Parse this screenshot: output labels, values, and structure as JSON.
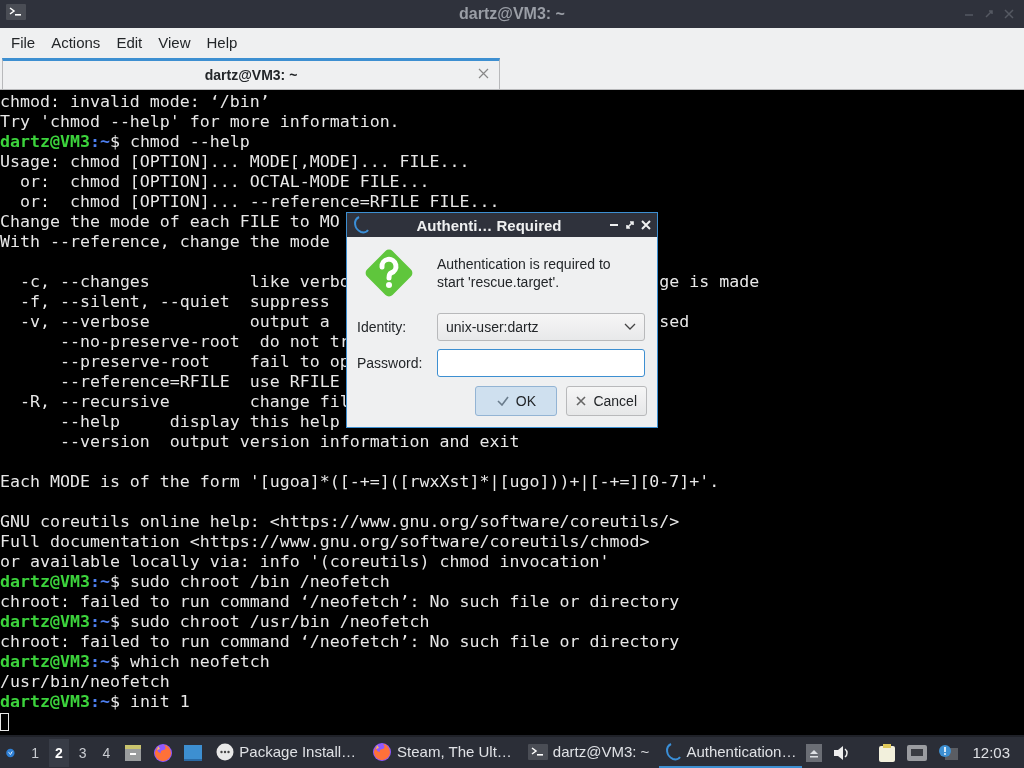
{
  "window": {
    "title": "dartz@VM3: ~"
  },
  "menu": [
    "File",
    "Actions",
    "Edit",
    "View",
    "Help"
  ],
  "tabs": [
    {
      "label": "dartz@VM3: ~",
      "selected": true
    }
  ],
  "terminal": {
    "lines": [
      {
        "kind": "output",
        "text": "chmod: invalid mode: ‘/bin’"
      },
      {
        "kind": "output",
        "text": "Try 'chmod --help' for more information."
      },
      {
        "kind": "prompt",
        "user": "dartz@VM3",
        "path": ":~",
        "command": "$ chmod --help"
      },
      {
        "kind": "output",
        "text": "Usage: chmod [OPTION]... MODE[,MODE]... FILE..."
      },
      {
        "kind": "output",
        "text": "  or:  chmod [OPTION]... OCTAL-MODE FILE..."
      },
      {
        "kind": "output",
        "text": "  or:  chmod [OPTION]... --reference=RFILE FILE..."
      },
      {
        "kind": "output",
        "text": "Change the mode of each FILE to MO"
      },
      {
        "kind": "output",
        "text": "With --reference, change the mode"
      },
      {
        "kind": "blank"
      },
      {
        "kind": "split",
        "left": "  -c, --changes          like verbo",
        "right": "ge is made"
      },
      {
        "kind": "output",
        "text": "  -f, --silent, --quiet  suppress"
      },
      {
        "kind": "split",
        "left": "  -v, --verbose          output a",
        "right": "sed"
      },
      {
        "kind": "output",
        "text": "      --no-preserve-root  do not tr"
      },
      {
        "kind": "output",
        "text": "      --preserve-root    fail to op"
      },
      {
        "kind": "output",
        "text": "      --reference=RFILE  use RFILE"
      },
      {
        "kind": "output",
        "text": "  -R, --recursive        change fil"
      },
      {
        "kind": "output",
        "text": "      --help     display this help"
      },
      {
        "kind": "output",
        "text": "      --version  output version information and exit"
      },
      {
        "kind": "blank"
      },
      {
        "kind": "output",
        "text": "Each MODE is of the form '[ugoa]*([-+=]([rwxXst]*|[ugo]))+|[-+=][0-7]+'."
      },
      {
        "kind": "blank"
      },
      {
        "kind": "output",
        "text": "GNU coreutils online help: <https://www.gnu.org/software/coreutils/>"
      },
      {
        "kind": "output",
        "text": "Full documentation <https://www.gnu.org/software/coreutils/chmod>"
      },
      {
        "kind": "output",
        "text": "or available locally via: info '(coreutils) chmod invocation'"
      },
      {
        "kind": "prompt",
        "user": "dartz@VM3",
        "path": ":~",
        "command": "$ sudo chroot /bin /neofetch"
      },
      {
        "kind": "output",
        "text": "chroot: failed to run command ‘/neofetch’: No such file or directory"
      },
      {
        "kind": "prompt",
        "user": "dartz@VM3",
        "path": ":~",
        "command": "$ sudo chroot /usr/bin /neofetch"
      },
      {
        "kind": "output",
        "text": "chroot: failed to run command ‘/neofetch’: No such file or directory"
      },
      {
        "kind": "prompt",
        "user": "dartz@VM3",
        "path": ":~",
        "command": "$ which neofetch"
      },
      {
        "kind": "output",
        "text": "/usr/bin/neofetch"
      },
      {
        "kind": "prompt",
        "user": "dartz@VM3",
        "path": ":~",
        "command": "$ init 1"
      },
      {
        "kind": "cursor"
      }
    ]
  },
  "dialog": {
    "title": "Authenti… Required",
    "message": "Authentication is required to start 'rescue.target'.",
    "identity_label": "Identity:",
    "identity_value": "unix-user:dartz",
    "password_label": "Password:",
    "buttons": [
      {
        "label": "OK",
        "default": true
      },
      {
        "label": "Cancel",
        "default": false
      }
    ]
  },
  "taskbar": {
    "workspaces": [
      {
        "label": "1",
        "selected": false
      },
      {
        "label": "2",
        "selected": true
      },
      {
        "label": "3",
        "selected": false
      },
      {
        "label": "4",
        "selected": false
      }
    ],
    "tasks": [
      {
        "label": "Package Install…",
        "selected": false
      },
      {
        "label": "Steam, The Ult…",
        "selected": false
      },
      {
        "label": "dartz@VM3: ~",
        "selected": false
      },
      {
        "label": "Authentication…",
        "selected": true
      }
    ],
    "clock": "12:03"
  }
}
